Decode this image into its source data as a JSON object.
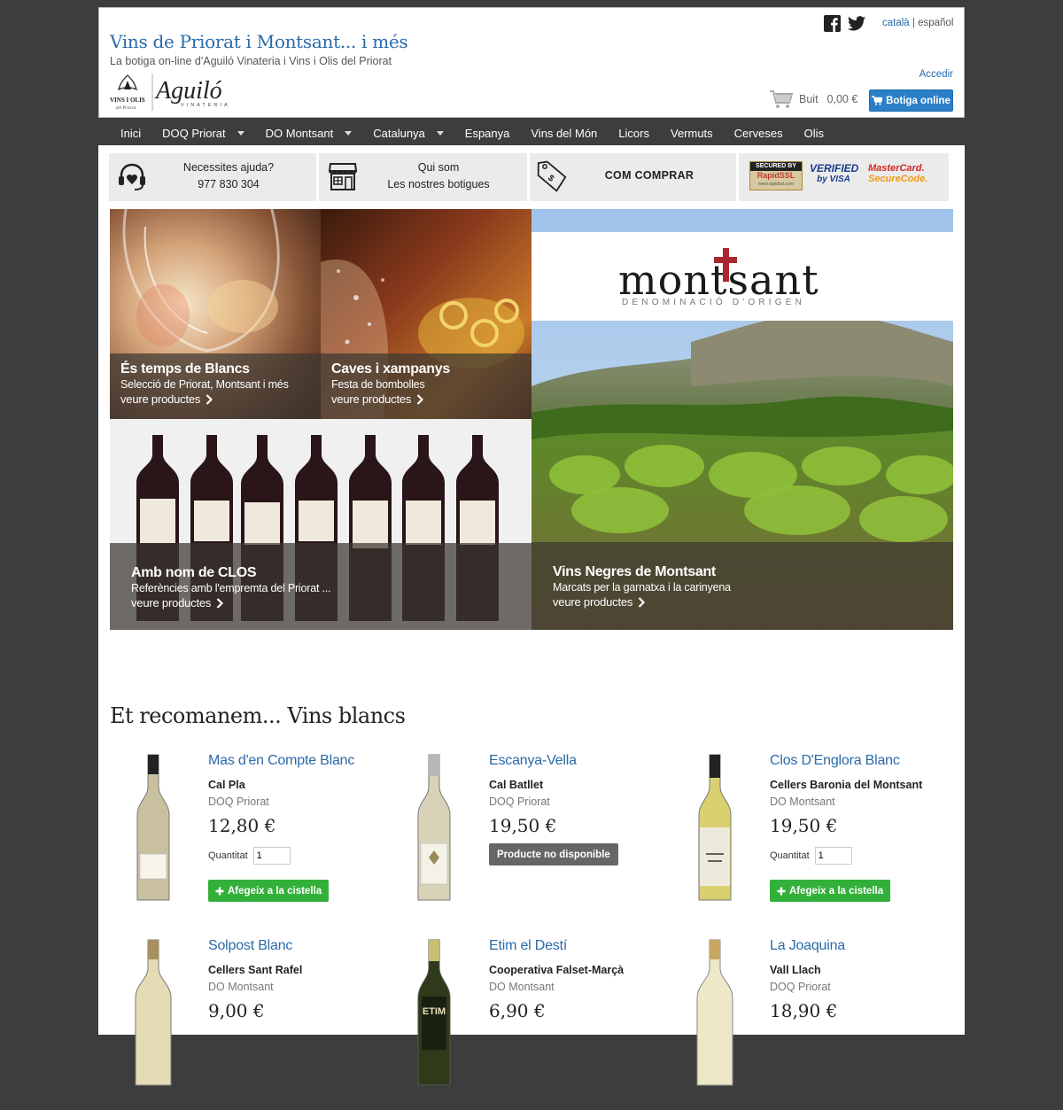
{
  "header": {
    "title": "Vins de Priorat i Montsant... i més",
    "subtitle": "La botiga on-line d'Aguiló Vinateria i Vins i Olis del Priorat",
    "logo_text": "Aguiló",
    "logo_small": "VINS I OLIS",
    "lang_current": "català",
    "lang_sep": "|",
    "lang_other": "español",
    "login": "Accedir",
    "cart_label": "Buit",
    "cart_amount": "0,00 €",
    "shop_button": "Botiga online"
  },
  "nav": [
    {
      "label": "Inici",
      "dropdown": false
    },
    {
      "label": "DOQ Priorat",
      "dropdown": true
    },
    {
      "label": "DO Montsant",
      "dropdown": true
    },
    {
      "label": "Catalunya",
      "dropdown": true
    },
    {
      "label": "Espanya",
      "dropdown": false
    },
    {
      "label": "Vins del Món",
      "dropdown": false
    },
    {
      "label": "Licors",
      "dropdown": false
    },
    {
      "label": "Vermuts",
      "dropdown": false
    },
    {
      "label": "Cerveses",
      "dropdown": false
    },
    {
      "label": "Olis",
      "dropdown": false
    }
  ],
  "info": {
    "help_title": "Necessites ajuda?",
    "help_phone": "977 830 304",
    "about_title": "Qui som",
    "about_sub": "Les nostres botigues",
    "how_to_buy": "COM COMPRAR",
    "badge_ssl_top": "SECURED BY",
    "badge_ssl": "RapidSSL",
    "badge_visa_top": "VERIFIED",
    "badge_visa": "by VISA",
    "badge_mc_top": "MasterCard.",
    "badge_mc": "SecureCode."
  },
  "tiles": [
    {
      "title": "És temps de Blancs",
      "sub": "Selecció de Priorat, Montsant i més",
      "link": "veure productes"
    },
    {
      "title": "Caves i xampanys",
      "sub": "Festa de bombolles",
      "link": "veure productes"
    },
    {
      "title": "Amb nom de CLOS",
      "sub": "Referències amb l'empremta del Priorat ...",
      "link": "veure productes"
    },
    {
      "title": "Vins Negres de Montsant",
      "sub": "Marcats per la garnatxa i la carinyena",
      "link": "veure productes",
      "logo": "montsant",
      "logo_sub": "DENOMINACIÓ D'ORIGEN"
    }
  ],
  "section_title": "Et recomanem... Vins blancs",
  "qty_label": "Quantitat",
  "add_label": "Afegeix a la cistella",
  "na_label": "Producte no disponible",
  "products": [
    {
      "name": "Mas d'en Compte Blanc",
      "maker": "Cal Pla",
      "do": "DOQ Priorat",
      "price": "12,80 €",
      "qty": "1",
      "available": true
    },
    {
      "name": "Escanya-Vella",
      "maker": "Cal Batllet",
      "do": "DOQ Priorat",
      "price": "19,50 €",
      "available": false
    },
    {
      "name": "Clos D'Englora Blanc",
      "maker": "Cellers Baronia del Montsant",
      "do": "DO Montsant",
      "price": "19,50 €",
      "qty": "1",
      "available": true
    },
    {
      "name": "Solpost Blanc",
      "maker": "Cellers Sant Rafel",
      "do": "DO Montsant",
      "price": "9,00 €"
    },
    {
      "name": "Etim el Destí",
      "maker": "Cooperativa Falset-Marçà",
      "do": "DO Montsant",
      "price": "6,90 €",
      "label": "ETIM"
    },
    {
      "name": "La Joaquina",
      "maker": "Vall Llach",
      "do": "DOQ Priorat",
      "price": "18,90 €"
    }
  ],
  "colors": {
    "link": "#2a6aaa",
    "primary_button": "#2a7fc7",
    "add_button": "#33b03a",
    "na_button": "#666666",
    "background": "#3d3d3d"
  }
}
